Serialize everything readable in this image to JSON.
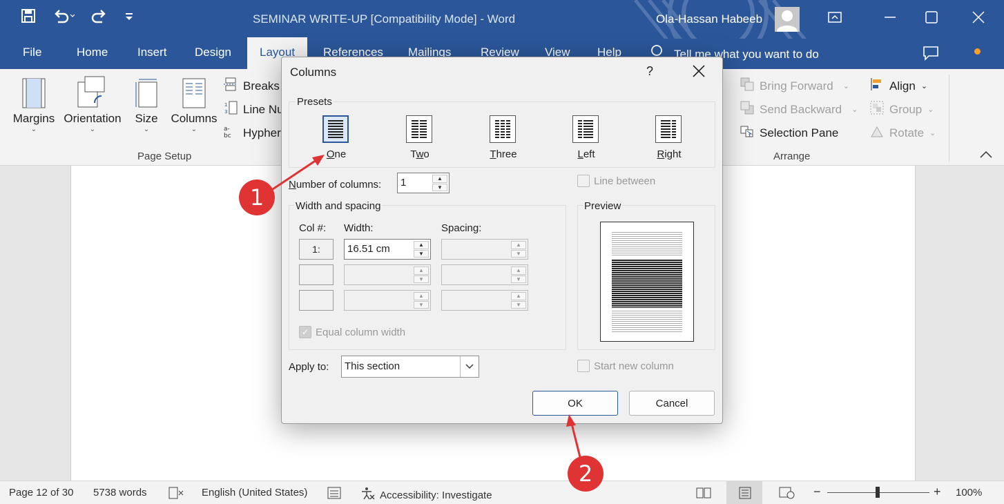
{
  "window": {
    "title": "SEMINAR WRITE-UP [Compatibility Mode]  -  Word",
    "user_name": "Ola-Hassan Habeeb"
  },
  "tabs": [
    "File",
    "Home",
    "Insert",
    "Design",
    "Layout",
    "References",
    "Mailings",
    "Review",
    "View",
    "Help"
  ],
  "active_tab": "Layout",
  "tell_me": "Tell me what you want to do",
  "ribbon": {
    "page_setup": {
      "margins": "Margins",
      "orientation": "Orientation",
      "size": "Size",
      "columns": "Columns",
      "breaks": "Breaks",
      "line_numbers": "Line Nu",
      "hyphenation": "Hypher",
      "group_label": "Page Setup"
    },
    "arrange": {
      "bring_forward": "Bring Forward",
      "send_backward": "Send Backward",
      "selection_pane": "Selection Pane",
      "align": "Align",
      "group": "Group",
      "rotate": "Rotate",
      "group_label": "Arrange"
    }
  },
  "dialog": {
    "title": "Columns",
    "help": "?",
    "presets_label": "Presets",
    "presets": [
      {
        "label": "One",
        "accel": "O",
        "rest": "ne",
        "selected": true
      },
      {
        "label": "Two",
        "accel": "w",
        "pre": "T",
        "rest": "o",
        "selected": false
      },
      {
        "label": "Three",
        "accel": "T",
        "rest": "hree",
        "selected": false
      },
      {
        "label": "Left",
        "accel": "L",
        "rest": "eft",
        "selected": false
      },
      {
        "label": "Right",
        "accel": "R",
        "rest": "ight",
        "selected": false
      }
    ],
    "num_columns_label_accel": "N",
    "num_columns_label_rest": "umber of columns:",
    "num_columns_value": "1",
    "line_between": "Line between",
    "width_spacing_label": "Width and spacing",
    "col_header": "Col #:",
    "width_header": "Width:",
    "spacing_header": "Spacing:",
    "rows": [
      {
        "col": "1:",
        "width": "16.51 cm",
        "spacing": ""
      },
      {
        "col": "",
        "width": "",
        "spacing": ""
      },
      {
        "col": "",
        "width": "",
        "spacing": ""
      }
    ],
    "equal_width": "Equal column width",
    "equal_width_checked": true,
    "preview_label": "Preview",
    "apply_to_label": "Apply to:",
    "apply_to_value": "This section",
    "start_new_column": "Start new column",
    "ok": "OK",
    "cancel": "Cancel"
  },
  "status": {
    "page": "Page 12 of 30",
    "words": "5738 words",
    "language": "English (United States)",
    "accessibility": "Accessibility: Investigate",
    "zoom_minus": "−",
    "zoom_plus": "+",
    "zoom": "100%"
  },
  "callouts": [
    "1",
    "2"
  ],
  "colors": {
    "accent": "#2b579a",
    "callout": "#e03333"
  }
}
